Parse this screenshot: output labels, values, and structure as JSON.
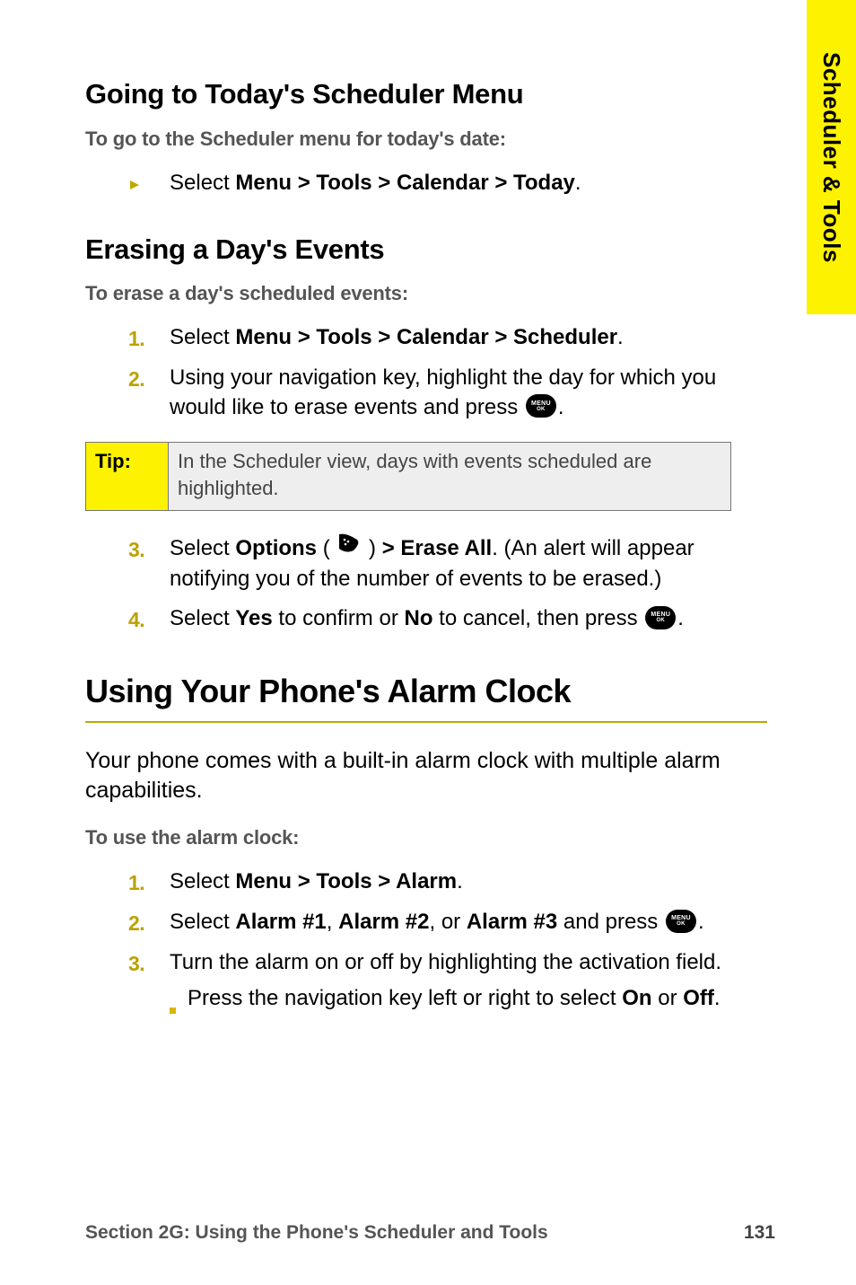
{
  "sideTab": "Scheduler & Tools",
  "section1": {
    "heading": "Going to Today's Scheduler Menu",
    "lead": "To go to the Scheduler menu for today's date:",
    "path_prefix": "Select ",
    "path_bold": "Menu > Tools > Calendar > Today",
    "path_suffix": "."
  },
  "section2": {
    "heading": "Erasing a Day's Events",
    "lead": "To erase a day's scheduled events:",
    "step1_prefix": "Select ",
    "step1_bold": "Menu > Tools > Calendar > Scheduler",
    "step1_suffix": ".",
    "step2_a": "Using your navigation key, highlight the day for which you would like to erase events and press ",
    "step2_b": ".",
    "tip_label": "Tip:",
    "tip_body": "In the Scheduler view, days with events scheduled are highlighted.",
    "step3_a": "Select ",
    "step3_b": "Options",
    "step3_c": " ( ",
    "step3_d": " ) ",
    "step3_e": "> Erase All",
    "step3_f": ". (An alert will appear notifying you of the number of events to be erased.)",
    "step4_a": "Select ",
    "step4_b": "Yes",
    "step4_c": " to confirm or ",
    "step4_d": "No",
    "step4_e": " to cancel, then press ",
    "step4_f": "."
  },
  "section3": {
    "heading": "Using Your Phone's Alarm Clock",
    "intro": "Your phone comes with a built-in alarm clock with multiple alarm capabilities.",
    "lead": "To use the alarm clock:",
    "step1_a": "Select ",
    "step1_b": "Menu > Tools > Alarm",
    "step1_c": ".",
    "step2_a": "Select ",
    "step2_b": "Alarm #1",
    "step2_c": ", ",
    "step2_d": "Alarm #2",
    "step2_e": ", or ",
    "step2_f": "Alarm #3",
    "step2_g": " and press ",
    "step2_h": ".",
    "step3": "Turn the alarm on or off by highlighting the activation field.",
    "sub_a": "Press the navigation key left or right to select ",
    "sub_b": "On",
    "sub_c": " or ",
    "sub_d": "Off",
    "sub_e": "."
  },
  "icons": {
    "menu_ok_l1": "MENU",
    "menu_ok_l2": "OK"
  },
  "footer": {
    "section": "Section 2G: Using the Phone's Scheduler and Tools",
    "page": "131"
  }
}
